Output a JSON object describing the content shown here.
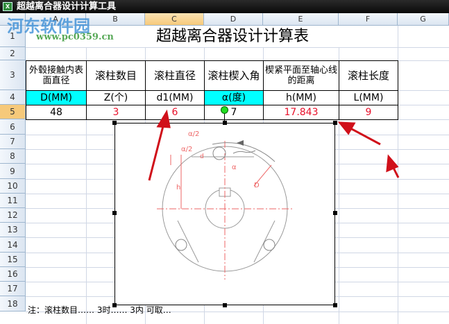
{
  "window": {
    "title": "超越离合器设计计算工具",
    "icon": "excel-icon"
  },
  "columns": [
    "A",
    "B",
    "C",
    "D",
    "E",
    "F",
    "G"
  ],
  "rows": [
    "1",
    "2",
    "3",
    "4",
    "5",
    "6",
    "7",
    "8",
    "9",
    "10",
    "11",
    "12",
    "13",
    "14",
    "15",
    "16",
    "17",
    "18"
  ],
  "sheet": {
    "title": "超越离合器设计计算表",
    "headers": [
      "外毂接触内表面直径",
      "滚柱数目",
      "滚柱直径",
      "滚柱楔入角",
      "楔紧平面至轴心线的距离",
      "滚柱长度"
    ],
    "units": [
      "D(MM)",
      "Z(个)",
      "d1(MM)",
      "α(度)",
      "h(MM)",
      "L(MM)"
    ],
    "values": [
      "48",
      "3",
      "6",
      "7",
      "17.843",
      "9"
    ],
    "row19_partial": "注：滚柱数目…… 3时…… 3内 可取…"
  },
  "watermark": {
    "name": "河东软件园",
    "url": "www.pc0359.cn"
  },
  "diagram_labels": {
    "alpha_half": "α/2",
    "alpha": "α",
    "h": "h",
    "D": "D",
    "d": "d"
  },
  "colors": {
    "cyan": "#00ffff",
    "red": "#e8102a",
    "selected": "#f6c97a"
  }
}
